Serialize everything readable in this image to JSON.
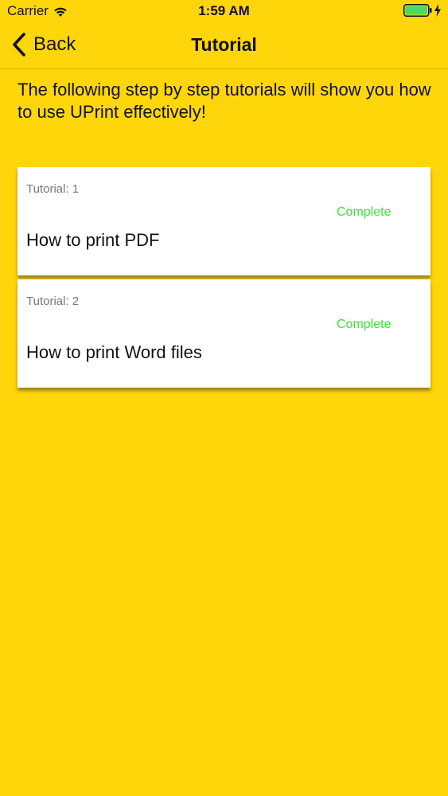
{
  "status_bar": {
    "carrier": "Carrier",
    "time": "1:59 AM",
    "wifi_icon": "wifi-icon",
    "battery_icon": "battery-icon",
    "charging_icon": "bolt-icon",
    "battery_color": "#4CD964"
  },
  "nav": {
    "back_label": "Back",
    "back_icon": "chevron-left-icon",
    "title": "Tutorial"
  },
  "intro": {
    "text": "The following step by step tutorials will show you how to use UPrint effectively!"
  },
  "tutorials": [
    {
      "number": "Tutorial: 1",
      "status": "Complete",
      "title": "How to print PDF"
    },
    {
      "number": "Tutorial: 2",
      "status": "Complete",
      "title": "How to print Word files"
    }
  ],
  "colors": {
    "background": "#FFD60A",
    "status_complete": "#3EE03A",
    "card": "#FFFFFF"
  }
}
